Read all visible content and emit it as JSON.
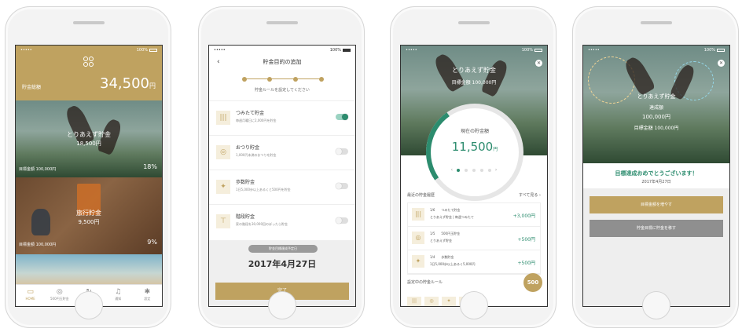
{
  "colors": {
    "accent": "#bfa260",
    "green": "#2c8c6e"
  },
  "screen1": {
    "status_left": "•••••",
    "status_right": "100%",
    "total_label": "貯金総額",
    "total_value": "34,500",
    "total_unit": "円",
    "cards": [
      {
        "name": "とりあえず貯金",
        "amount": "18,500円",
        "goal": "目標金額 100,000円",
        "pct": "18%"
      },
      {
        "name": "旅行貯金",
        "amount": "9,500円",
        "goal": "目標金額 100,000円",
        "pct": "9%"
      }
    ],
    "tabs": [
      {
        "label": "HOME",
        "icon": "▭"
      },
      {
        "label": "500円玉貯金",
        "icon": "◎"
      },
      {
        "label": "履歴",
        "icon": "↻"
      },
      {
        "label": "通知",
        "icon": "♫"
      },
      {
        "label": "設定",
        "icon": "✱"
      }
    ]
  },
  "screen2": {
    "status_left": "•••••",
    "status_right": "100%",
    "back": "‹",
    "title": "貯金目的の追加",
    "step_hint": "貯金ルールを設定してください",
    "rules": [
      {
        "title": "つみたて貯金",
        "desc": "毎週月曜日に2,000円を貯金",
        "icon": "|||",
        "on": true
      },
      {
        "title": "おつり貯金",
        "desc": "1,000円未満のおつりを貯金",
        "icon": "◎",
        "on": false
      },
      {
        "title": "歩数貯金",
        "desc": "1日5,000歩以上あるくと500円を貯金",
        "icon": "✦",
        "on": false
      },
      {
        "title": "階段貯金",
        "desc": "家の階段を30,000回のぼったら貯金",
        "icon": "⊤",
        "on": false
      }
    ],
    "date_pill": "貯金目標達成予定日",
    "date_value": "2017年4月27日",
    "done": "完了"
  },
  "screen3": {
    "status_left": "•••••",
    "status_right": "100%",
    "title": "とりあえず貯金",
    "goal": "目標金額 100,000円",
    "gauge_label": "現在の貯金額",
    "gauge_value": "11,500",
    "gauge_unit": "円",
    "pager_prev": "‹",
    "pager_next": "›",
    "history_header": "最近の貯金履歴",
    "history_more": "すべて見る ›",
    "history": [
      {
        "icon": "|||",
        "line1": "1/6　　つみたて貯金",
        "line2": "とりあえず貯金 | 毎週つみたて",
        "amount": "+3,000円"
      },
      {
        "icon": "◎",
        "line1": "1/5　　500円玉貯金",
        "line2": "とりあえず貯金",
        "amount": "+500円"
      },
      {
        "icon": "✦",
        "line1": "1/4　　歩数貯金",
        "line2": "1日5,000歩以上あるく5,000円",
        "amount": "+500円"
      }
    ],
    "rules_header": "設定中の貯金ルール",
    "fab": "500",
    "mini_icons": [
      "|||",
      "◎",
      "✦",
      "⊤"
    ]
  },
  "screen4": {
    "status_left": "•••••",
    "status_right": "100%",
    "close": "✕",
    "t1": "とりあえず貯金",
    "t2": "達成額",
    "t3": "100,000円",
    "t4": "目標金額 100,000円",
    "congrats": "目標達成おめでとうございます！",
    "date": "2017年4月27日",
    "btn1": "目標金額を増やす",
    "btn2": "貯金目標に貯金を移す"
  }
}
